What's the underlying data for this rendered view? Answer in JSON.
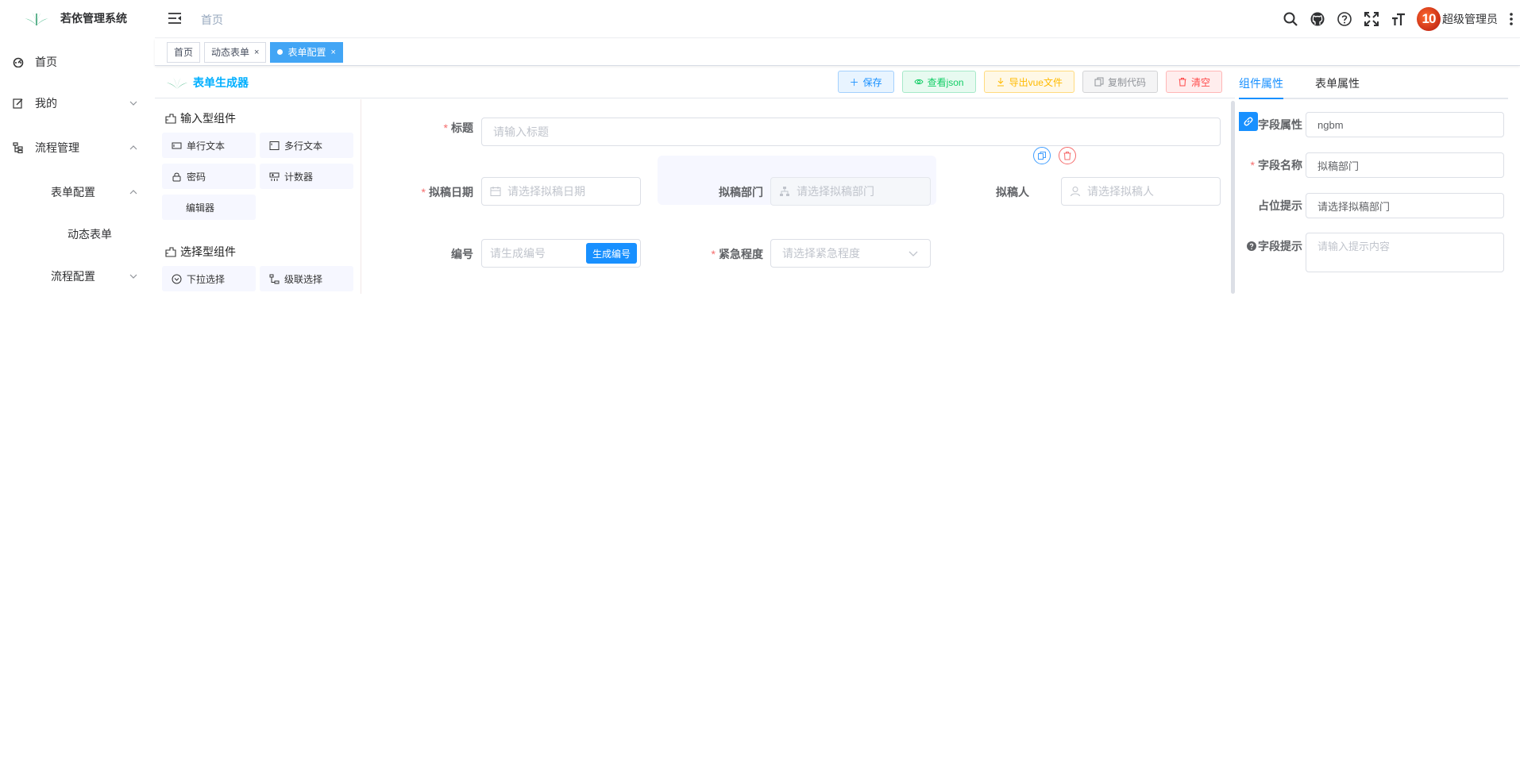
{
  "app": {
    "title": "若依管理系统"
  },
  "sidebar": {
    "items": [
      {
        "label": "首页",
        "icon": "dashboard-icon"
      },
      {
        "label": "我的",
        "icon": "edit-icon"
      },
      {
        "label": "流程管理",
        "icon": "tree-icon"
      },
      {
        "label": "表单配置"
      },
      {
        "label": "动态表单"
      },
      {
        "label": "流程配置"
      }
    ]
  },
  "header": {
    "breadcrumb": "首页",
    "username": "超级管理员",
    "avatar_text": "10"
  },
  "tags": [
    {
      "label": "首页"
    },
    {
      "label": "动态表单",
      "close": "×"
    },
    {
      "label": "表单配置",
      "close": "×"
    }
  ],
  "builder": {
    "title": "表单生成器",
    "buttons": {
      "save": "保存",
      "view_json": "查看json",
      "export_vue": "导出vue文件",
      "copy_code": "复制代码",
      "clear": "清空"
    },
    "categories": [
      {
        "title": "输入型组件",
        "items": [
          "单行文本",
          "多行文本",
          "密码",
          "计数器",
          "编辑器"
        ]
      },
      {
        "title": "选择型组件",
        "items": [
          "下拉选择",
          "级联选择"
        ]
      }
    ],
    "form": {
      "title_label": "标题",
      "title_placeholder": "请输入标题",
      "date_label": "拟稿日期",
      "date_placeholder": "请选择拟稿日期",
      "dept_label": "拟稿部门",
      "dept_placeholder": "请选择拟稿部门",
      "person_label": "拟稿人",
      "person_placeholder": "请选择拟稿人",
      "number_label": "编号",
      "number_placeholder": "请生成编号",
      "number_button": "生成编号",
      "urgency_label": "紧急程度",
      "urgency_placeholder": "请选择紧急程度",
      "required_mark": "*"
    }
  },
  "props_panel": {
    "tabs": [
      "组件属性",
      "表单属性"
    ],
    "field_attr_label": "字段属性",
    "field_attr_value": "ngbm",
    "field_name_label": "字段名称",
    "field_name_value": "拟稿部门",
    "placeholder_label": "占位提示",
    "placeholder_value": "请选择拟稿部门",
    "hint_label": "字段提示",
    "hint_placeholder": "请输入提示内容",
    "required_mark": "*"
  },
  "colors": {
    "primary": "#1890ff",
    "tag_active": "#42a5f5",
    "title_blue": "#00afff",
    "required": "#f56c6c"
  }
}
